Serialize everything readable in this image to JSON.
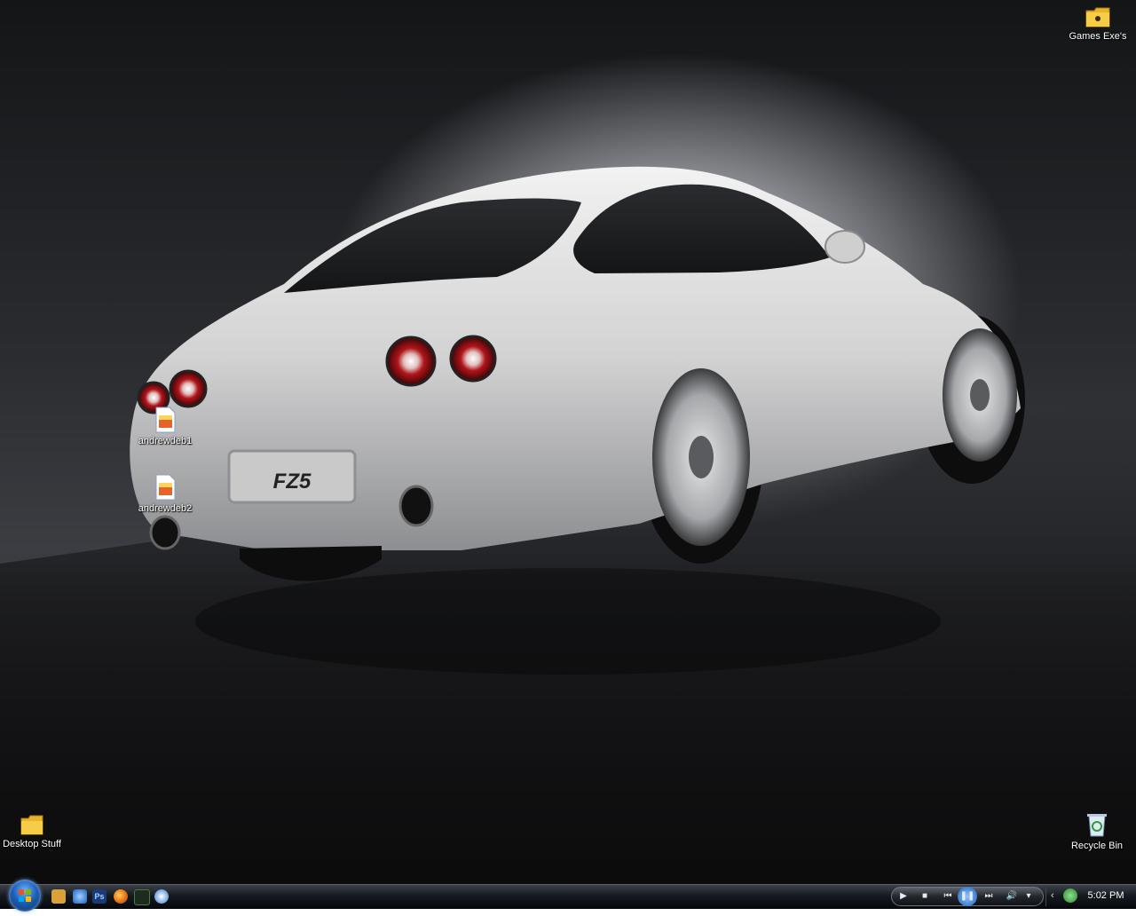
{
  "desktop": {
    "icons": {
      "games": "Games Exe's",
      "file1": "andrewdeb1",
      "file2": "andrewdeb2",
      "folder": "Desktop Stuff",
      "recycle": "Recycle Bin"
    },
    "wallpaper": {
      "plate_text": "FZ5",
      "car_color": "#d9d9d9"
    }
  },
  "taskbar": {
    "quick_launch": [
      "show-desktop-icon",
      "internet-explorer-icon",
      "photoshop-icon",
      "firefox-icon",
      "winamp-icon",
      "media-player-icon"
    ],
    "clock": "5:02 PM",
    "media_controls": [
      "play-icon",
      "stop-icon",
      "previous-icon",
      "pause-icon",
      "next-icon",
      "volume-icon"
    ]
  },
  "colors": {
    "taskbar": "#0d1015",
    "orb": "#1c5fb8",
    "taillight": "#b1151a"
  }
}
